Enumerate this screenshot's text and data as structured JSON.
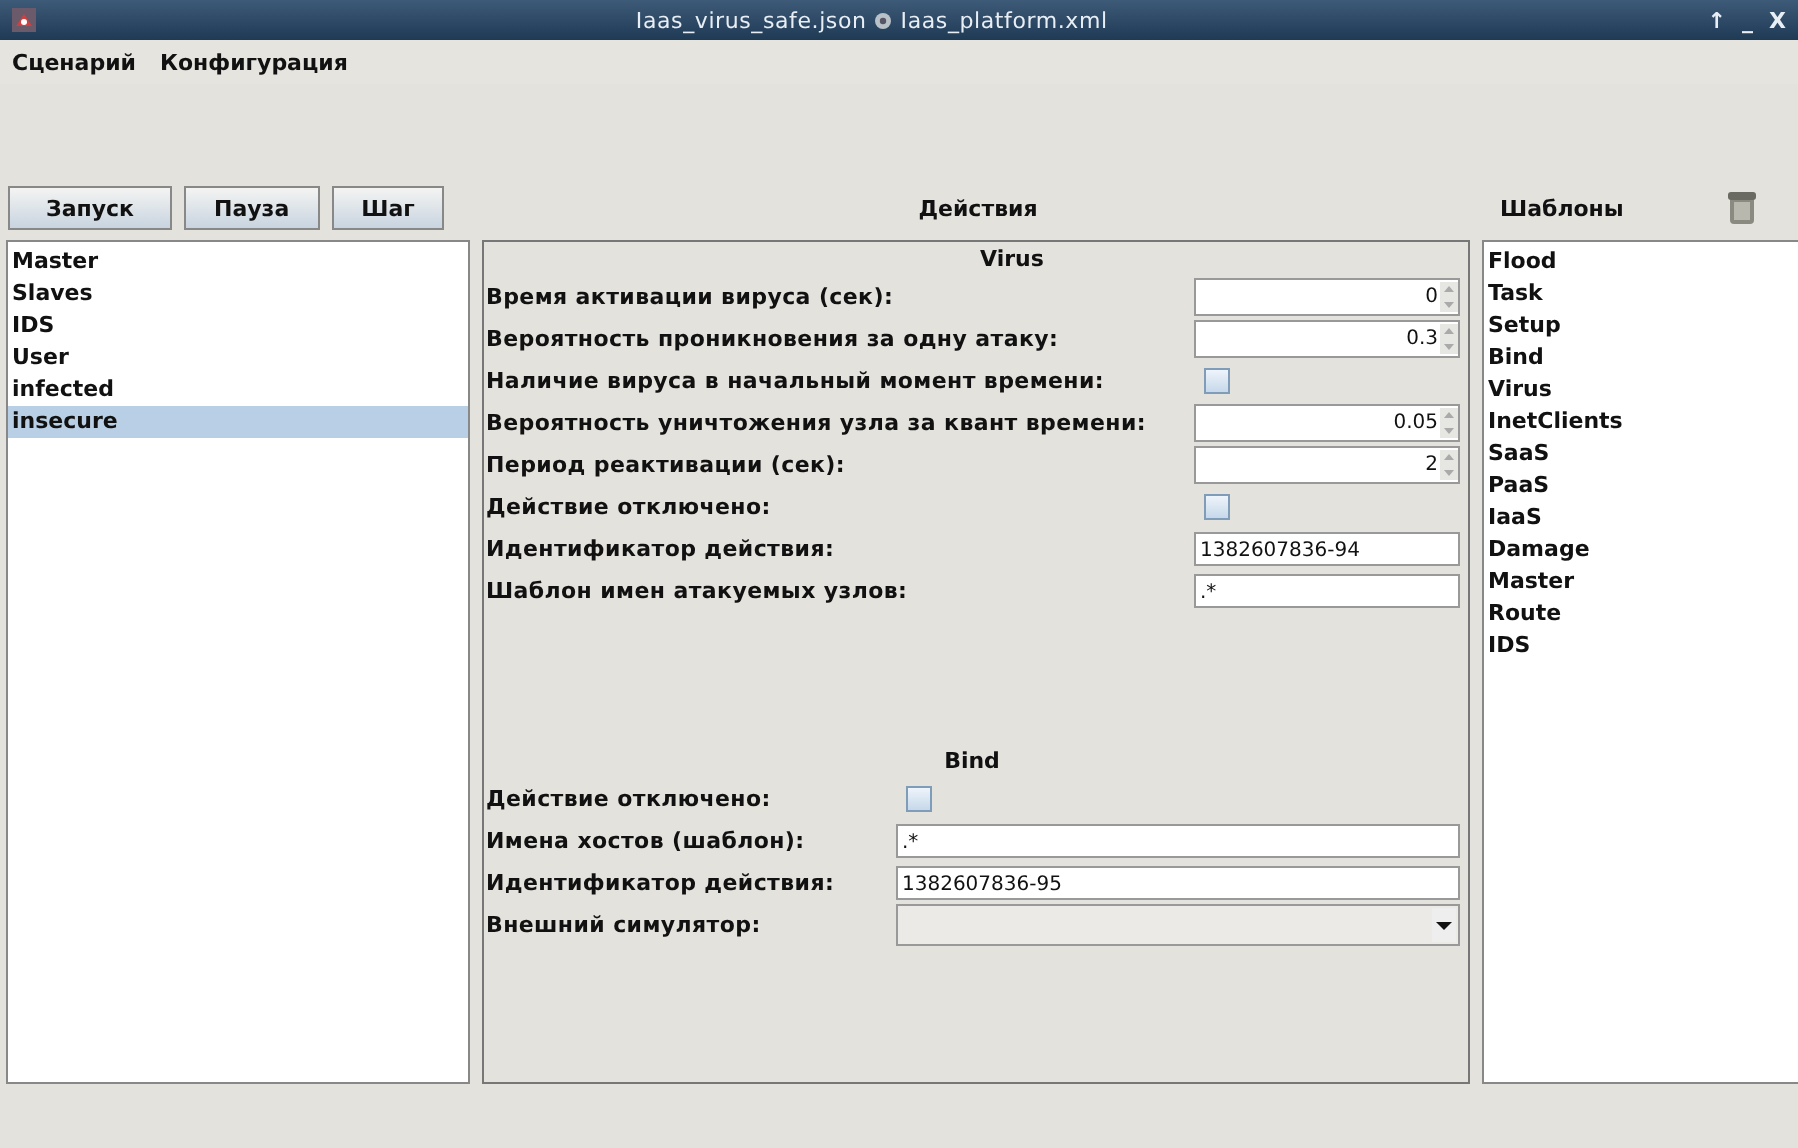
{
  "window": {
    "title_left": "Iaas_virus_safe.json",
    "title_right": "Iaas_platform.xml",
    "controls": [
      "↑",
      "_",
      "X"
    ]
  },
  "menu": [
    "Сценарий",
    "Конфигурация"
  ],
  "buttons": [
    "Запуск",
    "Пауза",
    "Шаг"
  ],
  "scenario_list": [
    {
      "label": "Master",
      "selected": false
    },
    {
      "label": "Slaves",
      "selected": false
    },
    {
      "label": "IDS",
      "selected": false
    },
    {
      "label": "User",
      "selected": false
    },
    {
      "label": "infected",
      "selected": false
    },
    {
      "label": "insecure",
      "selected": true
    }
  ],
  "actions": {
    "title": "Действия",
    "sections": [
      {
        "title": "Virus",
        "fields": [
          {
            "kind": "spinner",
            "label": "Время активации вируса (сек):",
            "value": "0"
          },
          {
            "kind": "spinner",
            "label": "Вероятность проникновения за одну атаку:",
            "value": "0.3"
          },
          {
            "kind": "checkbox",
            "label": "Наличие вируса в начальный момент времени:",
            "checked": false
          },
          {
            "kind": "spinner",
            "label": "Вероятность уничтожения узла за квант времени:",
            "value": "0.05"
          },
          {
            "kind": "spinner",
            "label": "Период реактивации (сек):",
            "value": "2"
          },
          {
            "kind": "checkbox",
            "label": "Действие отключено:",
            "checked": false
          },
          {
            "kind": "text",
            "label": "Идентификатор действия:",
            "value": "1382607836-94"
          },
          {
            "kind": "text",
            "label": "Шаблон имен атакуемых узлов:",
            "value": ".*"
          }
        ]
      },
      {
        "title": "Bind",
        "fields": [
          {
            "kind": "checkbox",
            "label": "Действие отключено:",
            "checked": false
          },
          {
            "kind": "text",
            "label": "Имена хостов (шаблон):",
            "value": ".*"
          },
          {
            "kind": "text",
            "label": "Идентификатор действия:",
            "value": "1382607836-95"
          },
          {
            "kind": "combo",
            "label": "Внешний симулятор:"
          }
        ]
      }
    ]
  },
  "templates": {
    "title": "Шаблоны",
    "items": [
      "Flood",
      "Task",
      "Setup",
      "Bind",
      "Virus",
      "InetClients",
      "SaaS",
      "PaaS",
      "IaaS",
      "Damage",
      "Master",
      "Route",
      "IDS"
    ]
  }
}
